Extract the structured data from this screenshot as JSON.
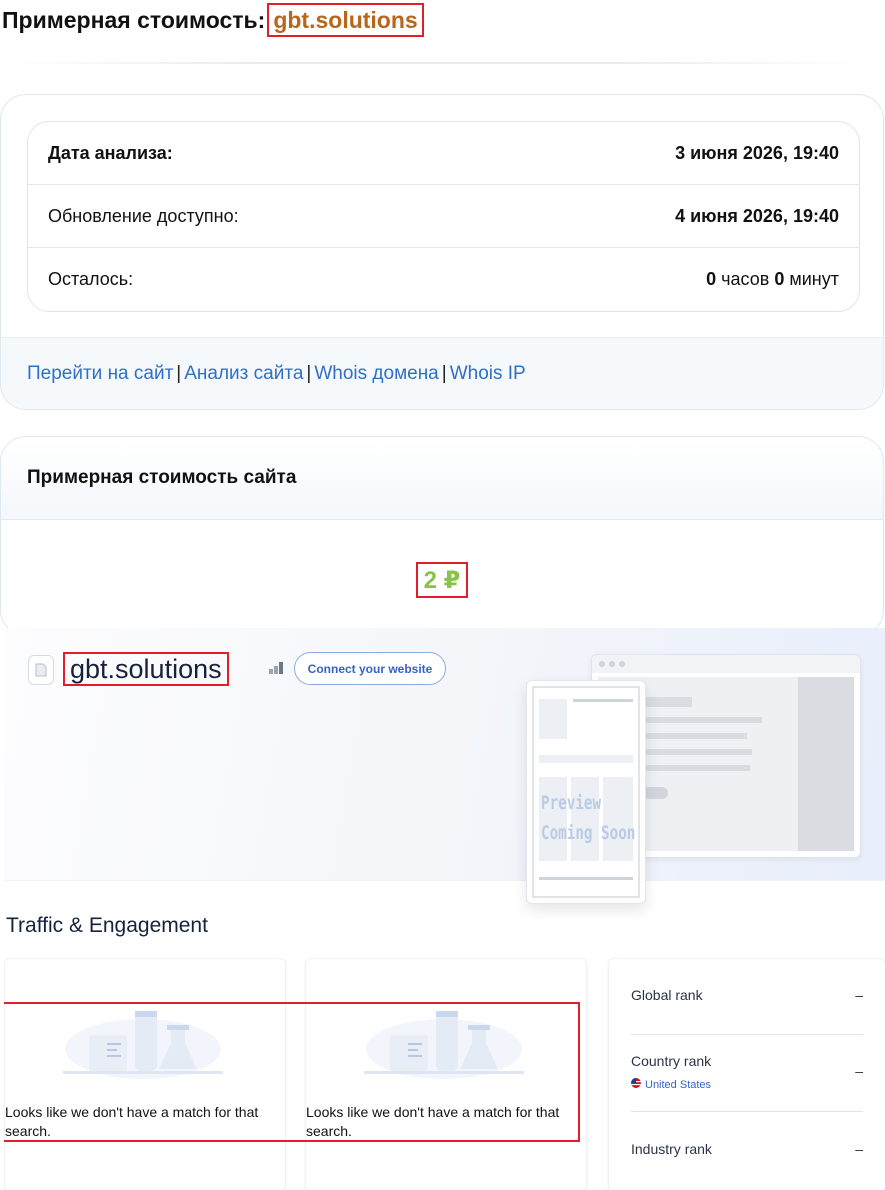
{
  "header": {
    "title_prefix": "Примерная стоимость:",
    "domain": "gbt.solutions"
  },
  "analysis": {
    "rows": [
      {
        "label": "Дата анализа:",
        "value": "3 июня 2026, 19:40"
      },
      {
        "label": "Обновление доступно:",
        "value": "4 июня 2026, 19:40"
      }
    ],
    "remaining": {
      "label": "Осталось:",
      "hours": "0",
      "hours_unit": "часов",
      "minutes": "0",
      "minutes_unit": "минут"
    }
  },
  "links": {
    "visit": "Перейти на сайт",
    "analyze": "Анализ сайта",
    "whois_domain": "Whois домена",
    "whois_ip": "Whois IP",
    "separator": "|"
  },
  "estimate": {
    "heading": "Примерная стоимость сайта",
    "value": "2 ₽",
    "value_color": "#8bc34a"
  },
  "embed": {
    "site_name": "gbt.solutions",
    "connect_button": "Connect your website",
    "preview_line1": "Preview",
    "preview_line2": "Coming Soon",
    "section_title": "Traffic & Engagement",
    "no_match_message": "Looks like we don't have a match for that search.",
    "ranks": {
      "global_label": "Global rank",
      "global_value": "–",
      "country_label": "Country rank",
      "country_value": "–",
      "country_name": "United States",
      "industry_label": "Industry rank",
      "industry_value": "–"
    }
  },
  "colors": {
    "accent_link": "#2f6fc8",
    "highlight_frame": "#e01f2a",
    "domain_text": "#b7661b",
    "price": "#8bc34a"
  },
  "icons": [
    "document-icon",
    "signal-bars-icon",
    "us-flag-icon",
    "lab-flask-illustration"
  ]
}
